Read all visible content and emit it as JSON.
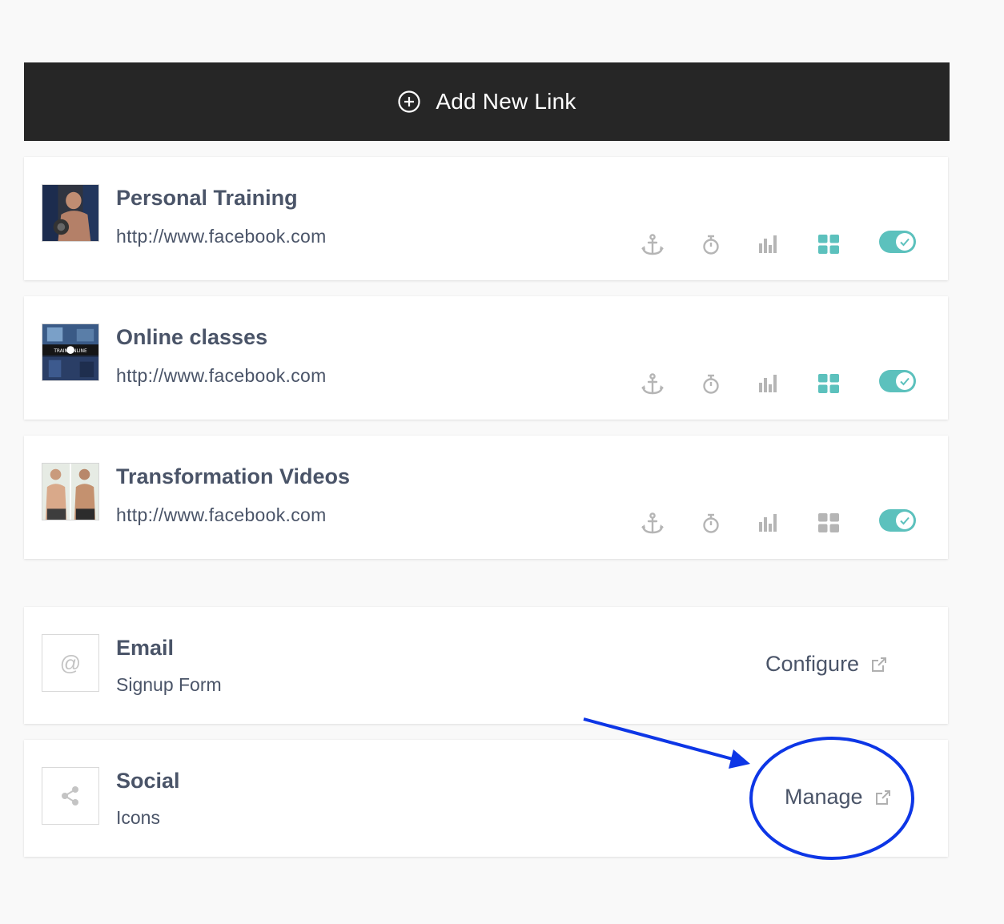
{
  "add_link": {
    "label": "Add New Link",
    "icon": "plus-circle-icon"
  },
  "links": [
    {
      "title": "Personal Training",
      "url": "http://www.facebook.com",
      "thumbnail": "gym-photo",
      "grid_active": true,
      "enabled": true
    },
    {
      "title": "Online classes",
      "url": "http://www.facebook.com",
      "thumbnail": "train-online-photo",
      "grid_active": true,
      "enabled": true
    },
    {
      "title": "Transformation Videos",
      "url": "http://www.facebook.com",
      "thumbnail": "before-after-photo",
      "grid_active": false,
      "enabled": true
    }
  ],
  "features": [
    {
      "title": "Email",
      "subtitle": "Signup Form",
      "icon": "at-icon",
      "icon_glyph": "@",
      "action": "Configure"
    },
    {
      "title": "Social",
      "subtitle": "Icons",
      "icon": "share-icon",
      "action": "Manage"
    }
  ],
  "link_tools": [
    "anchor-icon",
    "timer-icon",
    "analytics-icon",
    "grid-icon",
    "toggle-switch"
  ],
  "colors": {
    "accent": "#5cc1bd",
    "icon_gray": "#b5b5b5",
    "dark_bar": "#262626",
    "text": "#4a5468",
    "annotation": "#0d36e6"
  }
}
